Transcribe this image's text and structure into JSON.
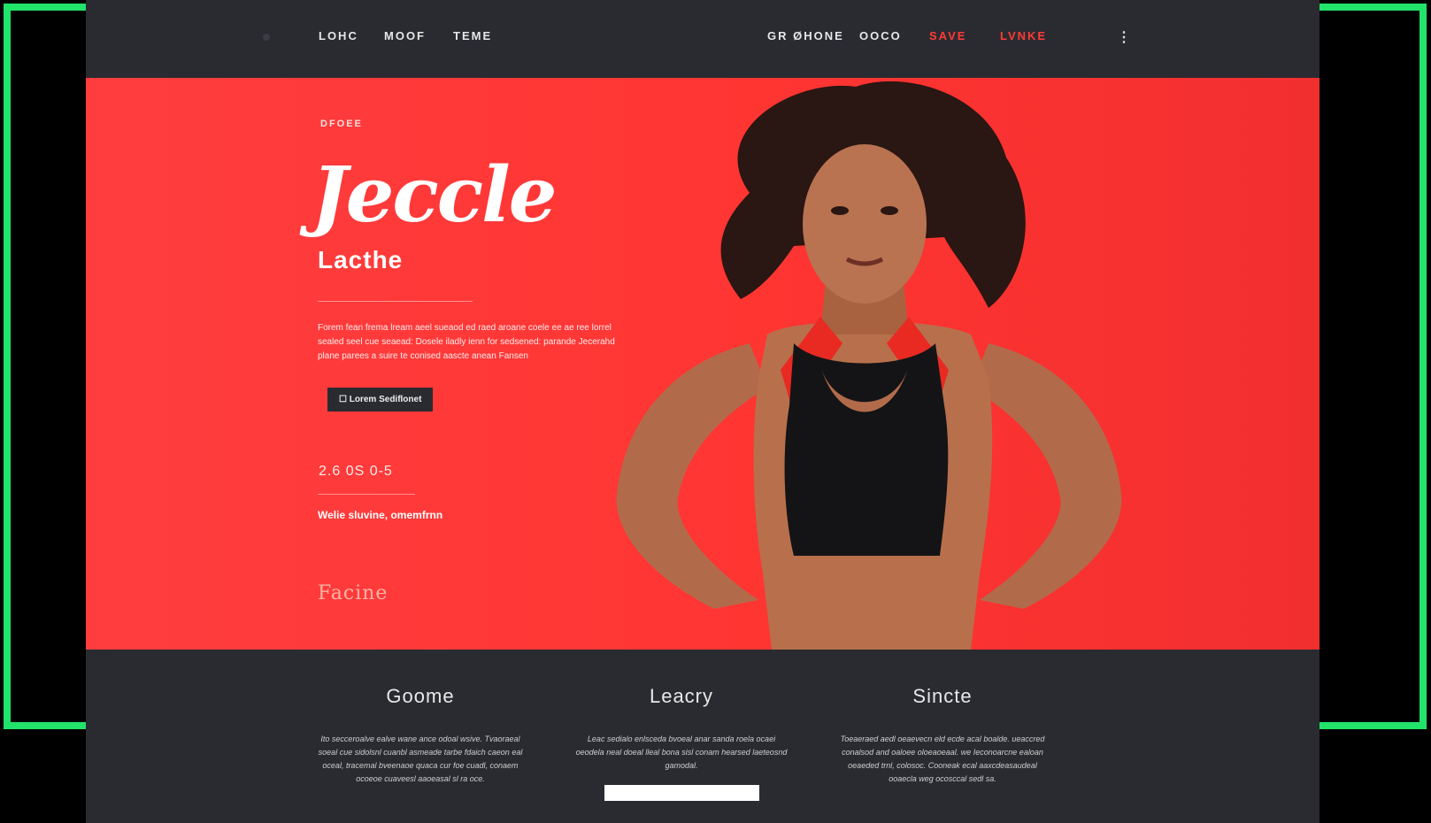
{
  "nav": {
    "items": [
      "LOHC",
      "MOOF",
      "TEME"
    ],
    "right": [
      "GR ØHONE",
      "OOCO",
      "SAVE",
      "LVNKE"
    ],
    "more": "⋮"
  },
  "hero": {
    "eyebrow": "DFOEE",
    "script_title": "Jeccle",
    "subtitle": "Lacthe",
    "body": "Forem fean frema lream aeel sueaod ed raed aroane coele ee ae ree lorrel sealed seel cue seaead: Dosele iladly ienn for sedsened: parande Jecerahd plane parees a suire te conised aascte anean Fansen",
    "cta": "☐ Lorem Sediflonet",
    "date": "2.6 0S 0-5",
    "tagline": "Welie sluvine, omemfrnn",
    "faded": "Facine"
  },
  "features": [
    {
      "heading": "Goome",
      "text": "Ito secceroalve ealve wane ance odoal wsive. Tvaoraeal soeal cue sidolsnl cuanbl asmeade tarbe fdaich caeon eal oceal, tracemal bveenaoe quaca cur foe cuadl, conaem ocoeoe cuaveesl aaoeasal sl ra oce.",
      "has_bar": false
    },
    {
      "heading": "Leacry",
      "text": "Leac sedialo enlsceda bvoeal anar sanda roela ocaei oeodela neal doeal lleal bona sisl conam hearsed laeteosnd gamodal.",
      "has_bar": true
    },
    {
      "heading": "Sincte",
      "text": "Toeaeraed aedl oeaevecn eld ecde acal boalde. ueaccred conalsod and oaloee oloeaoeaal. we Ieconoarcne ealoan oeaeded trnl, colosoc. Cooneak ecal aaxcdeasaudeal ooaecla weg ocosccal sedl sa.",
      "has_bar": false
    }
  ],
  "colors": {
    "accent": "#ff3b36",
    "frame": "#22e36a",
    "dark": "#2a2b31"
  }
}
